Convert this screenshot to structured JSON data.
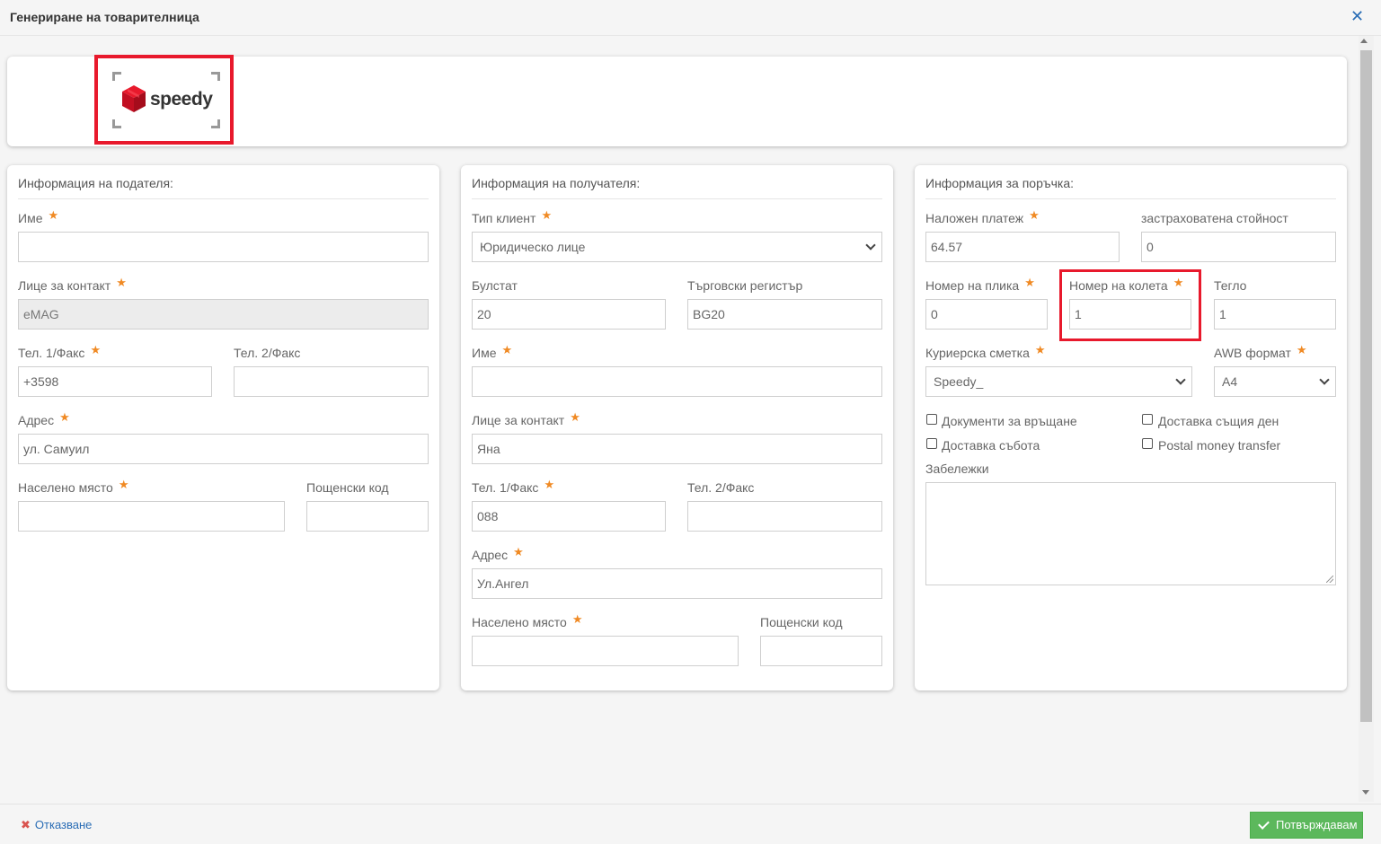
{
  "header": {
    "title": "Генериране на товарителница",
    "close_icon": "close-icon"
  },
  "logo": {
    "text": "speedy",
    "brand_color": "#e8192c"
  },
  "sender": {
    "title": "Информация на подателя:",
    "name_label": "Име",
    "name_value": "",
    "contact_label": "Лице за контакт",
    "contact_value": "eMAG",
    "phone1_label": "Тел. 1/Факс",
    "phone1_value": "+3598",
    "phone2_label": "Тел. 2/Факс",
    "phone2_value": "",
    "address_label": "Адрес",
    "address_value": "ул. Самуил",
    "city_label": "Населено място",
    "city_value": "",
    "zip_label": "Пощенски код",
    "zip_value": ""
  },
  "recipient": {
    "title": "Информация на получателя:",
    "client_type_label": "Тип клиент",
    "client_type_value": "Юридическо лице",
    "bulstat_label": "Булстат",
    "bulstat_value": "20",
    "trade_reg_label": "Търговски регистър",
    "trade_reg_value": "BG20",
    "name_label": "Име",
    "name_value": "",
    "contact_label": "Лице за контакт",
    "contact_value": "Яна",
    "phone1_label": "Тел. 1/Факс",
    "phone1_value": "088",
    "phone2_label": "Тел. 2/Факс",
    "phone2_value": "",
    "address_label": "Адрес",
    "address_value": "Ул.Ангел",
    "city_label": "Населено място",
    "city_value": "",
    "zip_label": "Пощенски код",
    "zip_value": ""
  },
  "order": {
    "title": "Информация за поръчка:",
    "cod_label": "Наложен платеж",
    "cod_value": "64.57",
    "insured_label": "застраховатена стойност",
    "insured_value": "0",
    "envelope_label": "Номер на плика",
    "envelope_value": "0",
    "parcels_label": "Номер на колета",
    "parcels_value": "1",
    "weight_label": "Тегло",
    "weight_value": "1",
    "account_label": "Куриерска сметка",
    "account_value": "Speedy_",
    "awb_label": "AWB формат",
    "awb_value": "A4",
    "return_docs_label": "Документи за връщане",
    "same_day_label": "Доставка същия ден",
    "saturday_label": "Доставка събота",
    "postal_money_label": "Postal money transfer",
    "notes_label": "Забележки",
    "notes_value": ""
  },
  "footer": {
    "cancel_label": "Отказване",
    "confirm_label": "Потвърждавам"
  },
  "colors": {
    "accent": "#2a6db5",
    "required_star": "#f08a24",
    "confirm_bg": "#5cb85c",
    "highlight": "#e8192c"
  }
}
